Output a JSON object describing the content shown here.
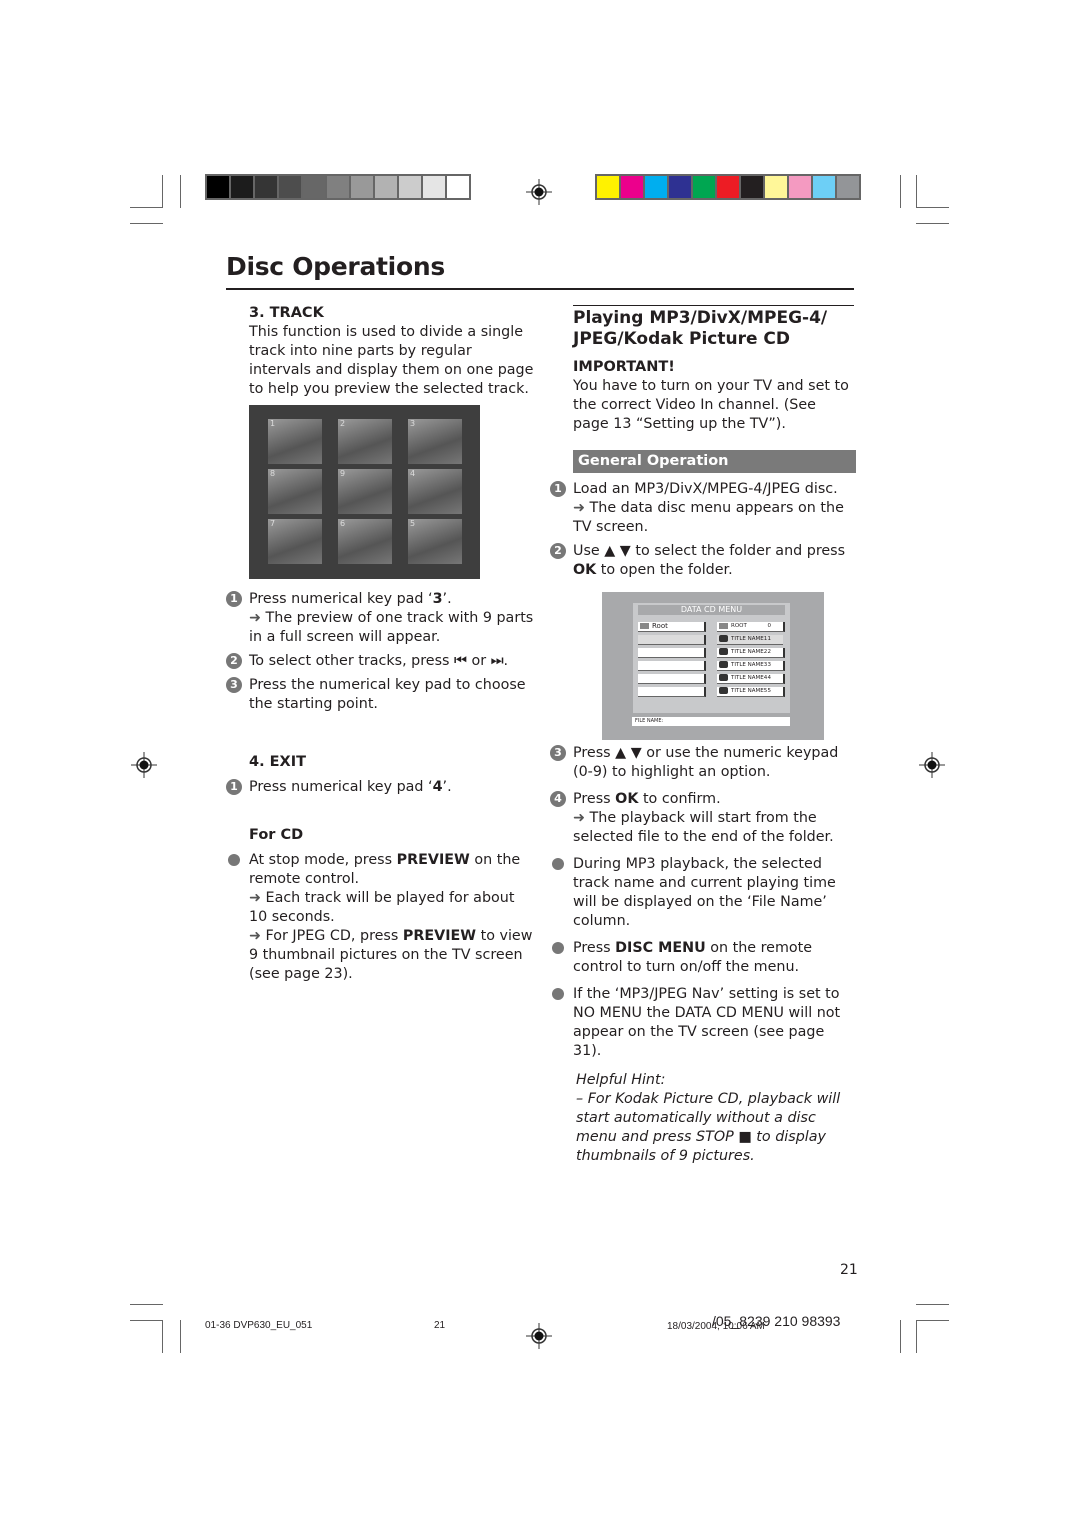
{
  "print_marks": {
    "grayscale_swatches": [
      "#000000",
      "#1c1c1c",
      "#353535",
      "#4d4d4d",
      "#676767",
      "#808080",
      "#999999",
      "#b2b2b2",
      "#cccccc",
      "#e5e5e5",
      "#ffffff"
    ],
    "color_swatches": [
      "#fff200",
      "#ec008c",
      "#00aeef",
      "#2e3192",
      "#00a651",
      "#ed1c24",
      "#231f20",
      "#fff799",
      "#f49ac1",
      "#6dcff6",
      "#939598"
    ]
  },
  "page": {
    "title": "Disc Operations",
    "page_number": "21"
  },
  "left": {
    "track": {
      "heading": "3. TRACK",
      "intro": "This function is used to divide a single track into nine parts by regular intervals and display them on one page to help you preview the selected track.",
      "thumbnails": [
        "1",
        "2",
        "3",
        "8",
        "9",
        "4",
        "7",
        "6",
        "5"
      ],
      "steps": [
        {
          "n": "1",
          "pre": "Press numerical key pad ‘",
          "bold": "3",
          "post": "’.",
          "arrow": "The preview of one track with 9 parts in a full screen will appear."
        },
        {
          "n": "2",
          "text": "To select other tracks, press ⏮ or ⏭."
        },
        {
          "n": "3",
          "text": "Press the numerical key pad to choose the starting point."
        }
      ]
    },
    "exit": {
      "heading": "4. EXIT",
      "steps": [
        {
          "n": "1",
          "pre": "Press numerical key pad ‘",
          "bold": "4",
          "post": "’."
        }
      ]
    },
    "for_cd": {
      "heading": "For CD",
      "b1_pre": "At stop mode, press ",
      "b1_bold": "PREVIEW",
      "b1_post": " on the remote control.",
      "arrow1": "Each track will be played for about 10 seconds.",
      "arrow2_pre": "For JPEG CD, press ",
      "arrow2_bold": "PREVIEW",
      "arrow2_post": " to view 9 thumbnail pictures on the TV screen (see page 23)."
    }
  },
  "right": {
    "heading": "Playing MP3/DivX/MPEG-4/ JPEG/Kodak Picture CD",
    "important_label": "IMPORTANT!",
    "important_text": "You have to turn on your TV and set to the correct Video In channel.  (See page 13 “Setting up the TV”).",
    "general_op": "General Operation",
    "s1": "Load an MP3/DivX/MPEG-4/JPEG disc.",
    "s1_arrow": "The data disc menu appears on the TV screen.",
    "s2_pre": "Use ▲ ▼ to select the folder and press ",
    "s2_bold": "OK",
    "s2_post": " to open the folder.",
    "menu": {
      "title": "DATA CD MENU",
      "left_items": [
        "Root",
        "",
        "",
        "",
        "",
        ""
      ],
      "right_items": [
        {
          "label": "ROOT",
          "num": "0",
          "icon": "folder"
        },
        {
          "label": "TITLE NAME1",
          "num": "1",
          "icon": "camera"
        },
        {
          "label": "TITLE NAME2",
          "num": "2",
          "icon": "camera"
        },
        {
          "label": "TITLE NAME3",
          "num": "3",
          "icon": "camera"
        },
        {
          "label": "TITLE NAME4",
          "num": "4",
          "icon": "camera"
        },
        {
          "label": "TITLE NAME5",
          "num": "5",
          "icon": "camera"
        }
      ],
      "file_name_label": "FILE NAME:"
    },
    "s3": "Press ▲ ▼ or use the numeric keypad (0-9) to highlight an option.",
    "s4_pre": "Press ",
    "s4_bold": "OK",
    "s4_post": " to confirm.",
    "s4_arrow": "The playback will start from the selected file to the end of the folder.",
    "b1": "During MP3 playback, the selected track name and current playing time will be displayed on the ‘File Name’ column.",
    "b2_pre": "Press ",
    "b2_bold": "DISC MENU",
    "b2_post": " on the remote control to turn on/off the menu.",
    "b3": "If the ‘MP3/JPEG Nav’ setting is set to NO MENU the DATA CD MENU will not appear on the TV screen (see page 31).",
    "hint_title": "Helpful Hint:",
    "hint_text": "–    For Kodak Picture CD, playback will start automatically without a disc menu and press STOP ■ to display thumbnails of 9 pictures."
  },
  "footer": {
    "file": "01-36 DVP630_EU_051",
    "page": "21",
    "date": "18/03/2004, 10:06 AM",
    "code": "/05_8239 210 98393"
  }
}
